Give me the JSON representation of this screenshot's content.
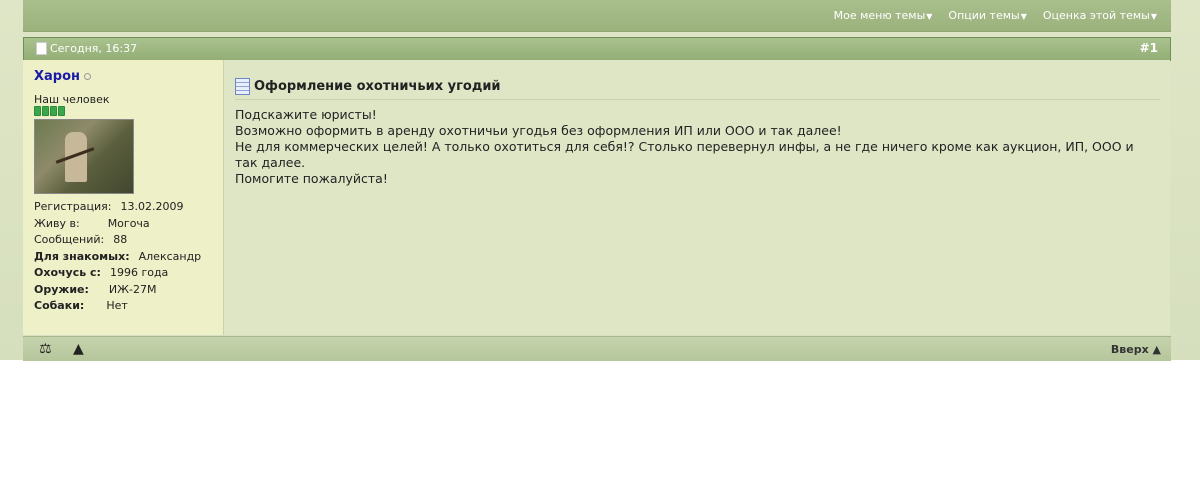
{
  "toolbar": {
    "menus": [
      {
        "label": "Мое меню темы"
      },
      {
        "label": "Опции темы"
      },
      {
        "label": "Оценка этой темы"
      }
    ]
  },
  "post": {
    "date": "Сегодня, 16:37",
    "number": "#1",
    "title": "Оформление охотничьих угодий",
    "lines": [
      "Подскажите юристы!",
      "Возможно оформить в аренду охотничьи угодья без оформления ИП или ООО и так далее!",
      "Не для коммерческих целей! А только охотиться для себя!? Столько перевернул инфы, а не где ничего кроме как аукцион, ИП, ООО и так далее.",
      "Помогите пожалуйста!"
    ]
  },
  "user": {
    "name": "Харон",
    "title": "Наш человек",
    "reputation_level": 4,
    "stats": [
      {
        "k": "Регистрация:",
        "v": "13.02.2009",
        "bold": false
      },
      {
        "k": "Живу в:",
        "v": "Могоча",
        "bold": false
      },
      {
        "k": "Сообщений:",
        "v": "88",
        "bold": false
      },
      {
        "k": "Для знакомых:",
        "v": "Александр",
        "bold": true
      },
      {
        "k": "Охочусь с:",
        "v": "1996 года",
        "bold": true
      },
      {
        "k": "Оружие:",
        "v": "ИЖ-27М",
        "bold": true
      },
      {
        "k": "Собаки:",
        "v": "Нет",
        "bold": true
      }
    ]
  },
  "footer": {
    "top_label": "Вверх ▲"
  },
  "icons": {
    "scales": "scales-icon",
    "warning": "warning-icon"
  }
}
